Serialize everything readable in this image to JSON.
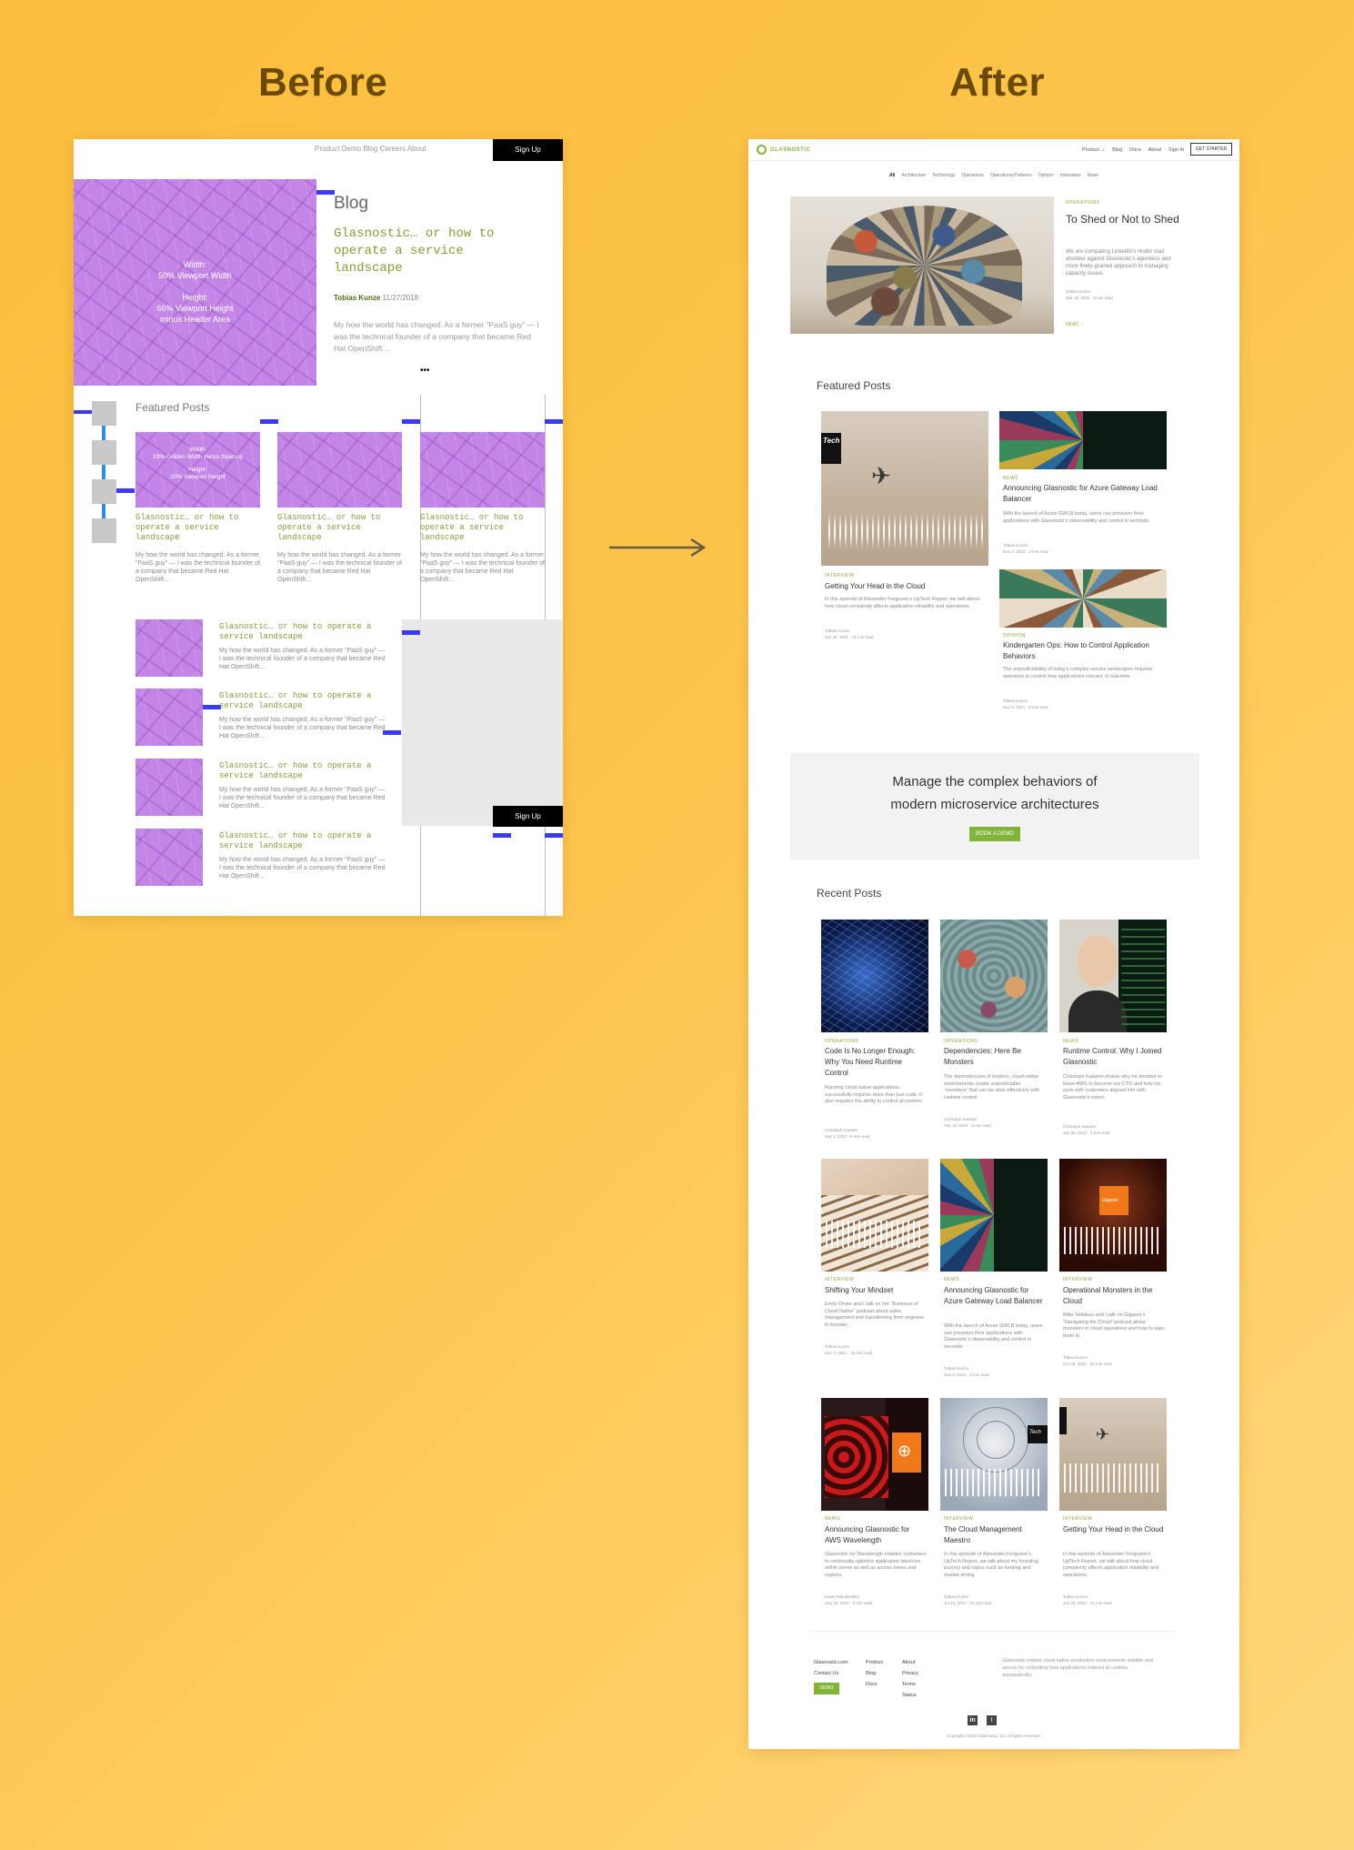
{
  "labels": {
    "before": "Before",
    "after": "After"
  },
  "before": {
    "nav_links": "Product Demo Blog Careers About",
    "signup": "Sign Up",
    "hero_box": {
      "width_label": "Width:",
      "width_value": "50% Viewport Width",
      "height_label": "Height:",
      "height_value": "66% Viewport Height minus Header Area"
    },
    "blog_heading": "Blog",
    "post_title": "Glasnostic… or how to operate a service landscape",
    "author": "Tobias Kunze",
    "date": "11/27/2018",
    "excerpt": "My how the world has changed. As a former “PaaS guy” — I was the technical founder of a company that became Red Hat OpenShift…",
    "more": "•••",
    "featured_heading": "Featured Posts",
    "card_box": {
      "width_label": "Width:",
      "width_value": "33% Golden Width minus Spacing",
      "height_label": "Height:",
      "height_value": "20% Viewport Height"
    },
    "card_title": "Glasnostic… or how to operate a service landscape",
    "card_excerpt": "My how the world has changed. As a former “PaaS guy” — I was the technical founder of a company that became Red Hat OpenShift…",
    "list_title": "Glasnostic… or how to operate a service landscape",
    "list_excerpt": "My how the world has changed. As a former “PaaS guy” — I was the technical founder of a company that became Red Hat OpenShift…",
    "signup2": "Sign Up"
  },
  "after": {
    "logo": "GLASNOSTIC",
    "nav": [
      "Product",
      "Blog",
      "Docs",
      "About",
      "Sign In"
    ],
    "cta": "GET STARTED",
    "filters": [
      "All",
      "Architecture",
      "Technology",
      "Operations",
      "Operational Patterns",
      "Opinion",
      "Interviews",
      "News"
    ],
    "hero": {
      "category": "OPERATIONS",
      "title": "To Shed or Not to Shed",
      "excerpt": "We are comparing LinkedIn's Hodor load shedder against Glasnostic's agentless and more finely-grained approach to managing capacity issues.",
      "author": "Tobias Kunze",
      "date": "Mar 15, 2022 · 8 min read",
      "read": "READ →"
    },
    "featured_heading": "Featured Posts",
    "featured": [
      {
        "category": "INTERVIEW",
        "title": "Getting Your Head in the Cloud",
        "excerpt": "In this episode of Alexander Ferguson's UpTech Report, we talk about how cloud complexity affects application reliability and operations.",
        "author": "Tobias Kunze",
        "date": "Jun 29, 2021 · 11 min read",
        "badge": "Tech"
      },
      {
        "category": "NEWS",
        "title": "Announcing Glasnostic for Azure Gateway Load Balancer",
        "excerpt": "With the launch of Azure GWLB today, users can provision their applications with Glasnostic's observability and control in seconds.",
        "author": "Tobias Kunze",
        "date": "Nov 2, 2021 · 3 min read"
      },
      {
        "category": "OPINION",
        "title": "Kindergarten Ops: How to Control Application Behaviors",
        "excerpt": "The unpredictability of today's complex service landscapes requires operators to control how applications interact, in real-time.",
        "author": "Tobias Kunze",
        "date": "Dec 8, 2021 · 8 min read"
      }
    ],
    "banner": {
      "line1": "Manage the complex behaviors of",
      "line2": "modern microservice architectures",
      "button": "BOOK A DEMO"
    },
    "recent_heading": "Recent Posts",
    "recent": [
      {
        "category": "OPERATIONS",
        "title": "Code Is No Longer Enough: Why You Need Runtime Control",
        "excerpt": "Running cloud native applications successfully requires more than just code. It also requires the ability to control at runtime.",
        "author": "Christoph Kaswen",
        "date": "Mar 1, 2022 · 6 min read"
      },
      {
        "category": "OPERATIONS",
        "title": "Dependencies: Here Be Monsters",
        "excerpt": "The dependencies of modern, cloud native environments create unpredictable “monsters” that can be slain effectively with runtime control.",
        "author": "Christoph Kaswen",
        "date": "Feb 16, 2022 · 6 min read"
      },
      {
        "category": "NEWS",
        "title": "Runtime Control: Why I Joined Glasnostic",
        "excerpt": "Christoph Kaswen shares why he decided to leave AWS to become our CTO and how his work with customers aligned him with Glasnostic's vision.",
        "author": "Christoph Kaswen",
        "date": "Jan 25, 2022 · 3 min read"
      },
      {
        "category": "INTERVIEW",
        "title": "Shifting Your Mindset",
        "excerpt": "Emily Omier and I talk on her “Business of Cloud Native” podcast about sales, management and transitioning from engineer to founder.",
        "author": "Tobias Kunze",
        "date": "Dec 7, 2021 · 20 min read"
      },
      {
        "category": "NEWS",
        "title": "Announcing Glasnostic for Azure Gateway Load Balancer",
        "excerpt": "With the launch of Azure GWLB today, users can provision their applications with Glasnostic's observability and control in seconds.",
        "author": "Tobias Kunze",
        "date": "Nov 2, 2021 · 3 min read"
      },
      {
        "category": "INTERVIEW",
        "title": "Operational Monsters in the Cloud",
        "excerpt": "Mike Vallabou and I talk on Gigaom's “Navigating the Cloud” podcast about monsters in cloud operations and how to slain them in.",
        "author": "Tobias Kunze",
        "date": "Oct 26, 2021 · 22 min read",
        "badge": "Gigaom"
      },
      {
        "category": "NEWS",
        "title": "Announcing Glasnostic for AWS Wavelength",
        "excerpt": "Glasnostic for Wavelength enables customers to continually optimize application latencies within zones as well as across zones and regions.",
        "author": "David Fasulfeckley",
        "date": "Sep 16, 2021 · 3 min read"
      },
      {
        "category": "INTERVIEW",
        "title": "The Cloud Management Maestro",
        "excerpt": "In this episode of Alexander Ferguson's UpTech Report, we talk about my founding journey and topics such as funding and market timing.",
        "author": "Tobias Kunze",
        "date": "Jul 13, 2021 · 10 min read",
        "badge": "Tech"
      },
      {
        "category": "INTERVIEW",
        "title": "Getting Your Head in the Cloud",
        "excerpt": "In this episode of Alexander Ferguson's UpTech Report, we talk about how cloud complexity affects application reliability and operations.",
        "author": "Tobias Kunze",
        "date": "Jun 29, 2021 · 11 min read"
      }
    ],
    "footer": {
      "col1": [
        "Glasnostic.com",
        "Contact Us"
      ],
      "demo": "DEMO",
      "col2": [
        "Product",
        "Blog",
        "Docs"
      ],
      "col3": [
        "About",
        "Privacy",
        "Terms",
        "Status"
      ],
      "about": "Glasnostic makes cloud native production environments reliable and secure by controlling how applications interact at runtime, automatically.",
      "copyright": "Copyright ©2022 Glasnostic, Inc. All rights reserved."
    }
  },
  "colors": {
    "background": "#fdc54e",
    "heading": "#6b4a07",
    "accent_green": "#82b43a",
    "purple": "#c486e6",
    "blue_marker": "#3a3af0"
  }
}
